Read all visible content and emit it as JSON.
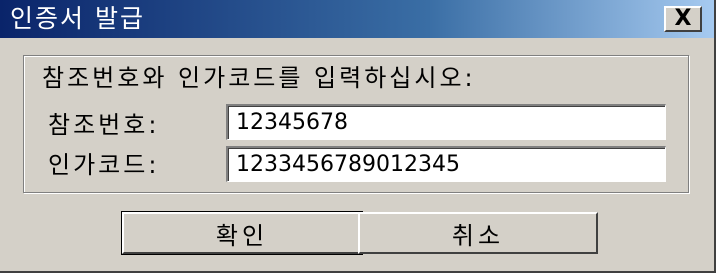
{
  "window": {
    "title": "인증서 발급",
    "close_label": "X"
  },
  "form": {
    "instruction": "참조번호와 인가코드를 입력하십시오:",
    "reference_label": "참조번호:",
    "reference_value": "12345678",
    "auth_code_label": "인가코드:",
    "auth_code_value": "1233456789012345"
  },
  "buttons": {
    "ok_label": "확인",
    "cancel_label": "취소"
  },
  "colors": {
    "titlebar_start": "#0a246a",
    "titlebar_end": "#a6caf0",
    "dialog_face": "#d4d0c8"
  }
}
